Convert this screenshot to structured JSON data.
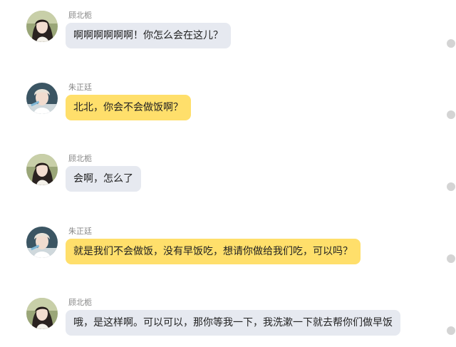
{
  "messages": [
    {
      "sender": "顾北栀",
      "text": "啊啊啊啊啊啊！你怎么会在这儿？",
      "avatar_icon": "girl-avatar-icon",
      "bubble_color": "#e6e9f0"
    },
    {
      "sender": "朱正廷",
      "text": "北北，你会不会做饭啊？",
      "avatar_icon": "boy-avatar-icon",
      "bubble_color": "#ffdf6b"
    },
    {
      "sender": "顾北栀",
      "text": "会啊，怎么了",
      "avatar_icon": "girl-avatar-icon",
      "bubble_color": "#e6e9f0"
    },
    {
      "sender": "朱正廷",
      "text": "就是我们不会做饭，没有早饭吃，想请你做给我们吃，可以吗？",
      "avatar_icon": "boy-avatar-icon",
      "bubble_color": "#ffdf6b"
    },
    {
      "sender": "顾北栀",
      "text": "哦，是这样啊。可以可以，那你等我一下，我洗漱一下就去帮你们做早饭",
      "avatar_icon": "girl-avatar-icon",
      "bubble_color": "#e6e9f0"
    }
  ]
}
